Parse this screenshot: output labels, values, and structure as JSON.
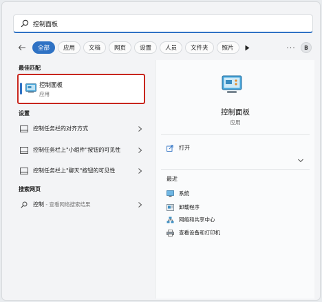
{
  "search": {
    "value": "控制面板",
    "placeholder": ""
  },
  "filters": {
    "tabs": [
      "全部",
      "应用",
      "文档",
      "网页",
      "设置",
      "人员",
      "文件夹",
      "照片"
    ],
    "active_index": 0,
    "more_label": "···",
    "avatar_letter": "B"
  },
  "best_match": {
    "section": "最佳匹配",
    "name": "控制面板",
    "type": "应用"
  },
  "settings": {
    "section": "设置",
    "items": [
      "控制任务栏的对齐方式",
      "控制任务栏上\"小组件\"按钮的可见性",
      "控制任务栏上\"聊天\"按钮的可见性"
    ]
  },
  "web": {
    "section": "搜索网页",
    "query": "控制",
    "hint": " - 查看网络搜索结果"
  },
  "detail": {
    "title": "控制面板",
    "subtitle": "应用",
    "open_label": "打开",
    "recent_section": "最近",
    "recent": [
      "系统",
      "卸载程序",
      "网络和共享中心",
      "查看设备和打印机"
    ]
  },
  "colors": {
    "accent": "#2f72c4",
    "highlight_border": "#c8261e"
  }
}
